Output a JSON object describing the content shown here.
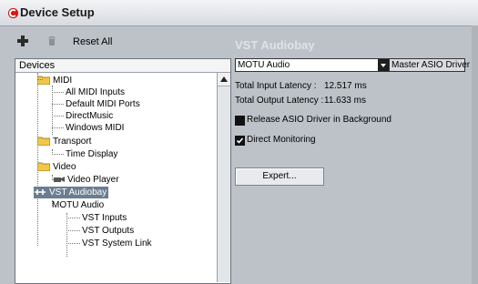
{
  "window": {
    "title": "Device Setup"
  },
  "toolbar": {
    "reset_label": "Reset All"
  },
  "devices": {
    "header": "Devices",
    "tree": [
      {
        "label": "MIDI"
      },
      {
        "label": "All MIDI Inputs"
      },
      {
        "label": "Default MIDI Ports"
      },
      {
        "label": "DirectMusic"
      },
      {
        "label": "Windows MIDI"
      },
      {
        "label": "Transport"
      },
      {
        "label": "Time Display"
      },
      {
        "label": "Video"
      },
      {
        "label": "Video Player"
      },
      {
        "label": "VST Audiobay"
      },
      {
        "label": "MOTU Audio"
      },
      {
        "label": "VST Inputs"
      },
      {
        "label": "VST Outputs"
      },
      {
        "label": "VST System Link"
      }
    ],
    "selected": "VST Audiobay"
  },
  "settings": {
    "title": "VST Audiobay",
    "driver_value": "MOTU Audio",
    "master_driver_label": "Master ASIO Driver",
    "input_latency_label": "Total Input Latency :",
    "input_latency_value": "12.517 ms",
    "output_latency_label": "Total Output Latency :",
    "output_latency_value": "11.633 ms",
    "release_label": "Release ASIO Driver in Background",
    "direct_monitoring_label": "Direct Monitoring",
    "release_checked": false,
    "direct_monitoring_checked": true,
    "expert_label": "Expert..."
  }
}
